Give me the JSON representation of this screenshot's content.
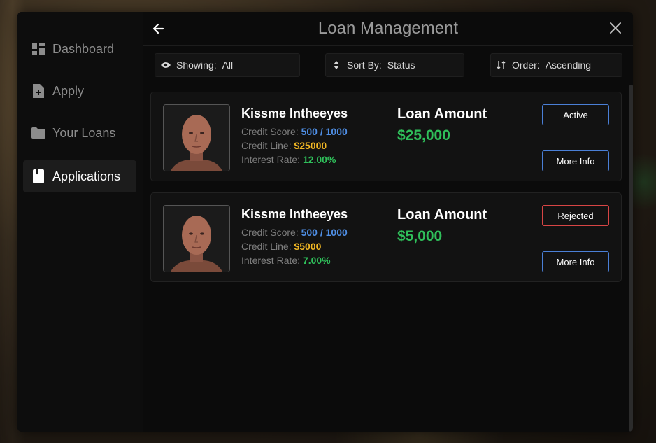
{
  "app": {
    "title": "Loan Management"
  },
  "sidebar": {
    "items": [
      {
        "label": "Dashboard",
        "icon": "dashboard-icon"
      },
      {
        "label": "Apply",
        "icon": "file-plus-icon"
      },
      {
        "label": "Your Loans",
        "icon": "folder-icon"
      },
      {
        "label": "Applications",
        "icon": "book-icon",
        "active": true
      }
    ]
  },
  "filters": {
    "showing": {
      "label": "Showing:",
      "value": "All",
      "icon": "eye-icon"
    },
    "sort": {
      "label": "Sort By:",
      "value": "Status",
      "icon": "sort-icon"
    },
    "order": {
      "label": "Order:",
      "value": "Ascending",
      "icon": "order-icon"
    }
  },
  "labels": {
    "credit_score": "Credit Score:",
    "credit_line": "Credit Line:",
    "interest_rate": "Interest Rate:",
    "loan_amount": "Loan Amount",
    "more_info": "More Info"
  },
  "applications": [
    {
      "name": "Kissme Intheeyes",
      "credit_score": "500 / 1000",
      "credit_line": "$25000",
      "interest_rate": "12.00%",
      "loan_amount": "$25,000",
      "status": "Active"
    },
    {
      "name": "Kissme Intheeyes",
      "credit_score": "500 / 1000",
      "credit_line": "$5000",
      "interest_rate": "7.00%",
      "loan_amount": "$5,000",
      "status": "Rejected"
    }
  ],
  "colors": {
    "accent_blue": "#4a7fd6",
    "reject_red": "#d84545",
    "money_green": "#2fbf5a",
    "credit_yellow": "#f2b824"
  }
}
